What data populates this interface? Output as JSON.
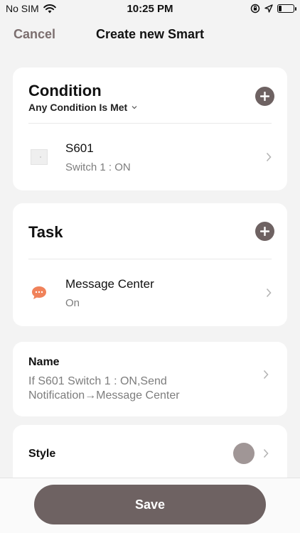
{
  "status_bar": {
    "carrier": "No SIM",
    "time": "10:25 PM",
    "battery_level": 0.2
  },
  "nav": {
    "cancel_label": "Cancel",
    "title": "Create new Smart"
  },
  "condition": {
    "title": "Condition",
    "mode_label": "Any Condition Is Met",
    "items": [
      {
        "title": "S601",
        "subtitle": "Switch 1 : ON",
        "icon": "device-switch-icon"
      }
    ]
  },
  "task": {
    "title": "Task",
    "items": [
      {
        "title": "Message Center",
        "subtitle": "On",
        "icon": "message-center-icon"
      }
    ]
  },
  "name": {
    "label": "Name",
    "value": "If S601 Switch 1 : ON,Send Notification→Message Center"
  },
  "style": {
    "label": "Style",
    "color": "#a09696"
  },
  "footer": {
    "save_label": "Save"
  },
  "colors": {
    "accent": "#6e6262",
    "message_icon": "#f0825a"
  }
}
